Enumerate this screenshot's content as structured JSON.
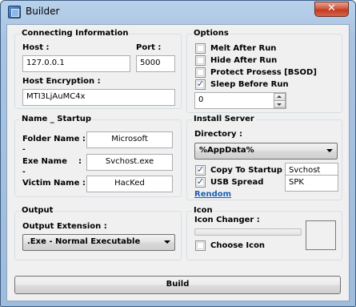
{
  "window": {
    "title": "Builder",
    "close_glyph": "✕"
  },
  "connecting": {
    "title": "Connecting Information",
    "host_label": "Host :",
    "host_value": "127.0.0.1",
    "port_label": "Port :",
    "port_value": "5000",
    "encryption_label": "Host Encryption :",
    "encryption_value": "MTI3LjAuMC4x"
  },
  "options": {
    "title": "Options",
    "items": [
      {
        "label": "Melt After Run",
        "checked": false
      },
      {
        "label": "Hide After Run",
        "checked": false
      },
      {
        "label": "Protect Prosess [BSOD]",
        "checked": false
      },
      {
        "label": "Sleep Before Run",
        "checked": true
      }
    ],
    "sleep_value": "0"
  },
  "startup": {
    "title": "Name _ Startup",
    "folder_label": "Folder Name :",
    "folder_value": "Microsoft",
    "exe_label": "Exe Name",
    "exe_colon": ":",
    "exe_value": "Svchost.exe",
    "victim_label": "Victim Name :",
    "victim_value": "HacKed",
    "dash": "-"
  },
  "install": {
    "title": "Install Server",
    "directory_label": "Directory :",
    "directory_value": "%AppData%",
    "copy_label": "Copy To Startup",
    "copy_checked": true,
    "copy_value": "Svchost",
    "usb_label": "USB Spread",
    "usb_checked": true,
    "usb_value": "SPK",
    "random_label": "Rendom"
  },
  "output": {
    "title": "Output",
    "extension_label": "Output Extension :",
    "extension_value": ".Exe - Normal Executable"
  },
  "icon": {
    "title": "Icon",
    "changer_label": "Icon Changer :",
    "choose_label": "Choose Icon",
    "choose_checked": false
  },
  "build_label": "Build"
}
